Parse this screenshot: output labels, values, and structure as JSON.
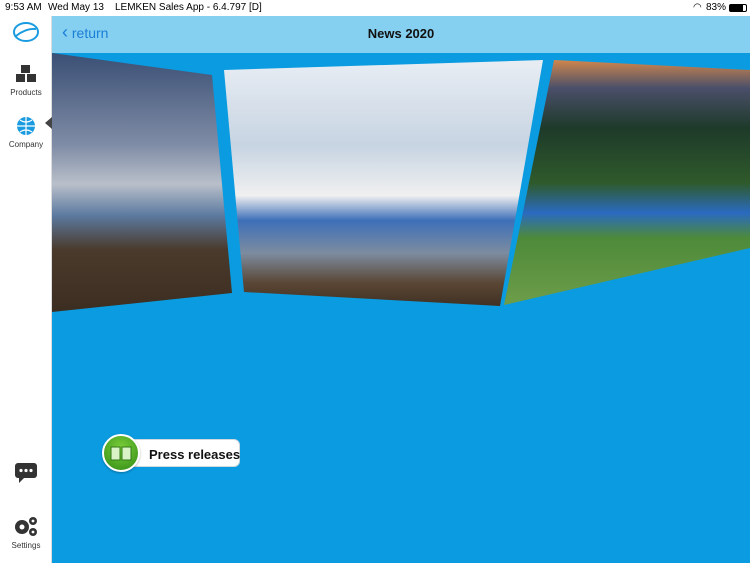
{
  "status_bar": {
    "time": "9:53 AM",
    "date": "Wed May 13",
    "app": "LEMKEN Sales App - 6.4.797 [D]",
    "battery": "83%"
  },
  "sidebar": {
    "items": [
      {
        "label": "Products"
      },
      {
        "label": "Company"
      },
      {
        "label": "Settings"
      }
    ]
  },
  "header": {
    "back_label": "return",
    "title": "News 2020"
  },
  "main": {
    "press_label": "Press releases"
  }
}
